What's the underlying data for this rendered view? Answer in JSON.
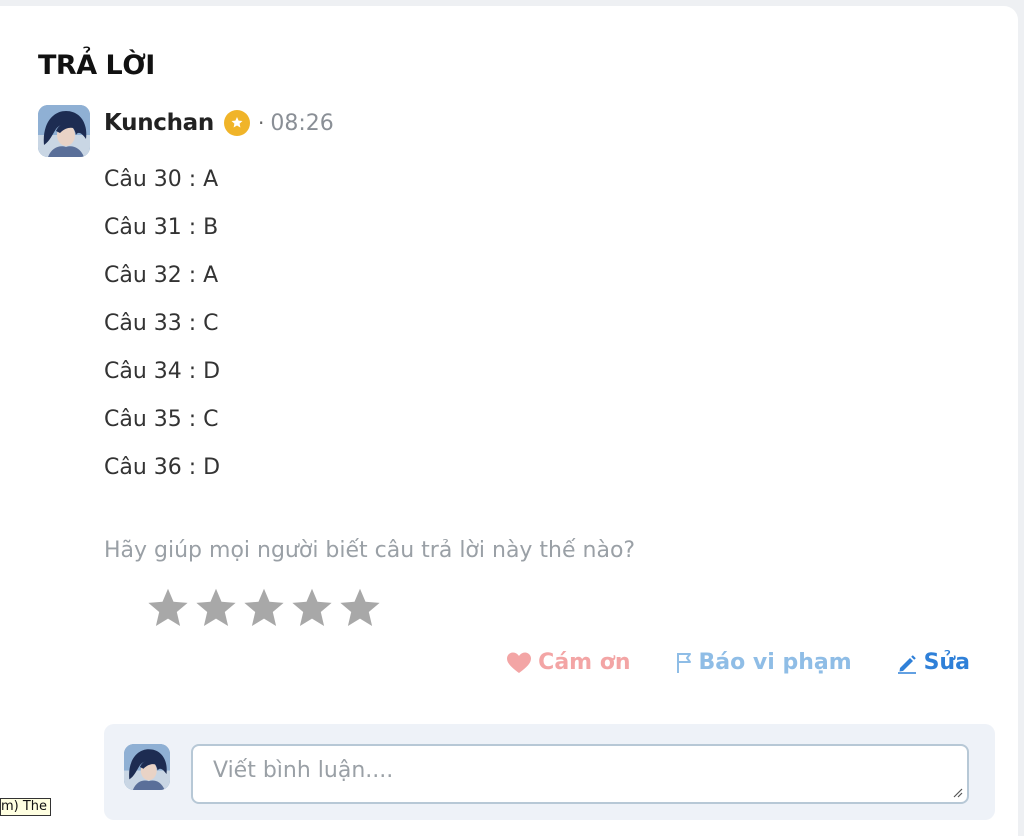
{
  "section": {
    "title": "TRẢ LỜI"
  },
  "post": {
    "author": "Kunchan",
    "verified_icon": "verified-badge-icon",
    "separator": "·",
    "time": "08:26",
    "answers": [
      "Câu 30 : A",
      "Câu 31 : B",
      "Câu 32 : A",
      "Câu 33 : C",
      "Câu 34 : D",
      "Câu 35 : C",
      "Câu 36 : D"
    ]
  },
  "rating": {
    "prompt": "Hãy giúp mọi người biết câu trả lời này thế nào?",
    "max_stars": 5,
    "selected_stars": 0,
    "star_color": "#a8a8a8"
  },
  "actions": {
    "thanks_label": "Cám ơn",
    "report_label": "Báo vi phạm",
    "edit_label": "Sửa"
  },
  "comment": {
    "placeholder": "Viết bình luận...."
  },
  "tooltip": {
    "text": "m) The"
  },
  "colors": {
    "thanks": "#f3a5a5",
    "report": "#8fbde6",
    "edit": "#2f80d8",
    "badge": "#f0b429"
  }
}
